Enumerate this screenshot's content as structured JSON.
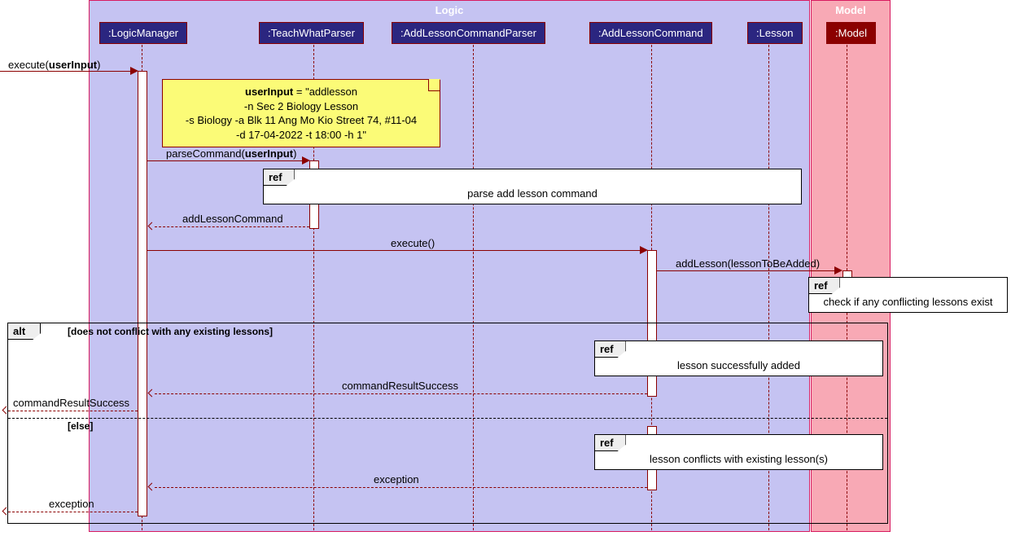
{
  "containers": {
    "logic": "Logic",
    "model": "Model"
  },
  "participants": {
    "logicManager": ":LogicManager",
    "teachWhatParser": ":TeachWhatParser",
    "addLessonCommandParser": ":AddLessonCommandParser",
    "addLessonCommand": ":AddLessonCommand",
    "lesson": ":Lesson",
    "model": ":Model"
  },
  "note": {
    "l1a": "userInput",
    "l1b": " =  \"addlesson",
    "l2": "-n Sec 2 Biology Lesson",
    "l3": "-s Biology -a Blk 11 Ang Mo Kio Street 74, #11-04",
    "l4": "-d 17-04-2022 -t 18:00 -h 1\""
  },
  "messages": {
    "executeUserInputA": "execute(",
    "executeUserInputB": "userInput",
    "executeUserInputC": ")",
    "parseCommandA": "parseCommand(",
    "parseCommandB": "userInput",
    "parseCommandC": ")",
    "addLessonCommandReturn": "addLessonCommand",
    "executeEmpty": "execute()",
    "addLesson": "addLesson(lessonToBeAdded)",
    "commandResultSuccess": "commandResultSuccess",
    "commandResultSuccessOut": "commandResultSuccess",
    "exceptionInner": "exception",
    "exceptionOut": "exception"
  },
  "refs": {
    "parseAddLessonCommand": "parse add lesson command",
    "checkConflicting": "check if any conflicting lessons exist",
    "lessonSuccessfullyAdded": "lesson successfully added",
    "lessonConflicts": "lesson conflicts with existing lesson(s)"
  },
  "alt": {
    "tag": "alt",
    "guardIf": "[does not conflict with any existing lessons]",
    "guardElse": "[else]",
    "refTag": "ref"
  }
}
